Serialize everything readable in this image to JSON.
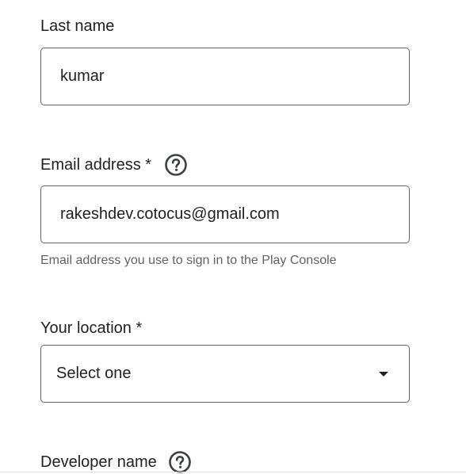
{
  "last_name": {
    "label": "Last name",
    "value": "kumar"
  },
  "email": {
    "label": "Email address *",
    "value": "rakeshdev.cotocus@gmail.com",
    "helper": "Email address you use to sign in to the Play Console",
    "help_icon": "help-circle-icon"
  },
  "location": {
    "label": "Your location *",
    "selected": "Select one",
    "dropdown_icon": "dropdown-arrow-icon"
  },
  "developer_name": {
    "label": "Developer name",
    "help_icon": "help-circle-icon"
  }
}
